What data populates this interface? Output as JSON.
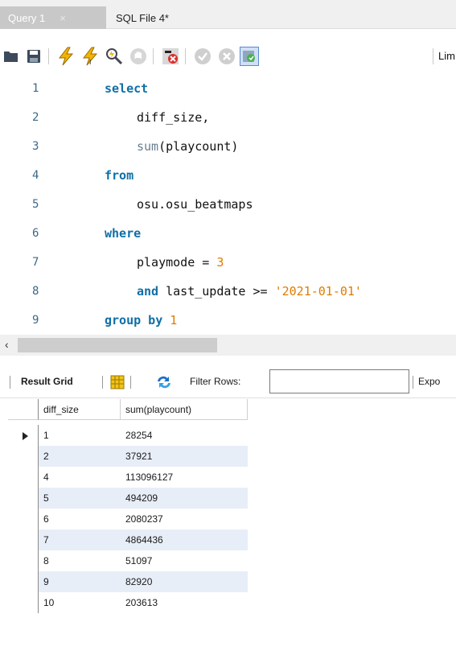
{
  "tabs": [
    {
      "label": "Query 1",
      "close": "×"
    },
    {
      "label": "SQL File 4*"
    }
  ],
  "toolbar": {
    "icons": [
      "open-folder-icon",
      "save-icon",
      "execute-icon",
      "execute-current-icon",
      "explain-icon",
      "stop-icon",
      "toggle-error-icon",
      "commit-icon",
      "rollback-icon",
      "autocommit-icon"
    ],
    "limit_label": "Lim"
  },
  "editor": {
    "lines": [
      {
        "n": "1",
        "tokens": [
          {
            "t": "kw",
            "v": "select"
          }
        ]
      },
      {
        "n": "2",
        "tokens": [
          {
            "t": "plain",
            "v": "diff_size,"
          }
        ]
      },
      {
        "n": "3",
        "tokens": [
          {
            "t": "fn",
            "v": "sum"
          },
          {
            "t": "plain",
            "v": "(playcount)"
          }
        ]
      },
      {
        "n": "4",
        "tokens": [
          {
            "t": "kw",
            "v": "from"
          }
        ]
      },
      {
        "n": "5",
        "tokens": [
          {
            "t": "plain",
            "v": "osu.osu_beatmaps"
          }
        ]
      },
      {
        "n": "6",
        "tokens": [
          {
            "t": "kw",
            "v": "where"
          }
        ]
      },
      {
        "n": "7",
        "tokens": [
          {
            "t": "plain",
            "v": "playmode = "
          },
          {
            "t": "num",
            "v": "3"
          }
        ]
      },
      {
        "n": "8",
        "tokens": [
          {
            "t": "kw",
            "v": "and "
          },
          {
            "t": "plain",
            "v": "last_update >= "
          },
          {
            "t": "str",
            "v": "'2021-01-01'"
          }
        ]
      },
      {
        "n": "9",
        "tokens": [
          {
            "t": "kw",
            "v": "group by "
          },
          {
            "t": "num",
            "v": "1"
          }
        ]
      }
    ]
  },
  "scrollbar": {
    "left_arrow": "‹"
  },
  "results": {
    "grid_label": "Result Grid",
    "filter_label": "Filter Rows:",
    "filter_value": "",
    "export_label": "Expo",
    "columns": [
      "diff_size",
      "sum(playcount)"
    ],
    "rows": [
      [
        "1",
        "28254"
      ],
      [
        "2",
        "37921"
      ],
      [
        "4",
        "113096127"
      ],
      [
        "5",
        "494209"
      ],
      [
        "6",
        "2080237"
      ],
      [
        "7",
        "4864436"
      ],
      [
        "8",
        "51097"
      ],
      [
        "9",
        "82920"
      ],
      [
        "10",
        "203613"
      ]
    ]
  },
  "colors": {
    "keyword": "#0f6fa6",
    "number": "#e07b00",
    "line_number": "#3a6a8a",
    "stripe": "#e8eef8"
  }
}
